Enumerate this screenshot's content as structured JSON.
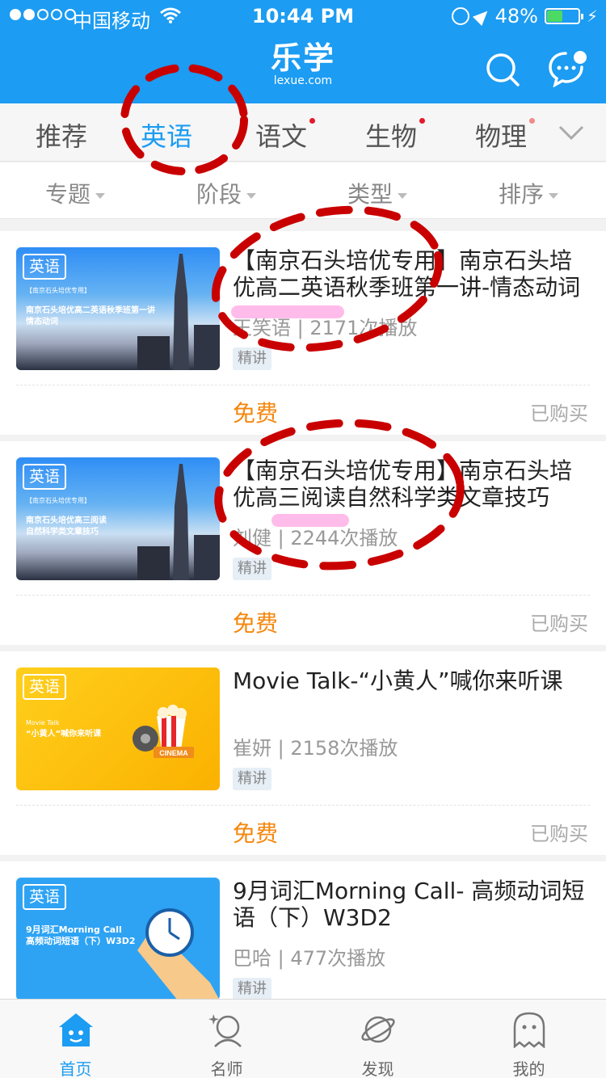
{
  "status_bar": {
    "carrier": "中国移动",
    "time": "10:44 PM",
    "battery": "48%",
    "battery_level": 0.48
  },
  "header": {
    "logo": "乐学",
    "logo_sub": "lexue.com"
  },
  "tabs": [
    {
      "label": "推荐",
      "active": false,
      "badge": false
    },
    {
      "label": "英语",
      "active": true,
      "badge": false
    },
    {
      "label": "语文",
      "active": false,
      "badge": true
    },
    {
      "label": "生物",
      "active": false,
      "badge": true
    },
    {
      "label": "物理",
      "active": false,
      "badge": true
    }
  ],
  "filters": [
    {
      "label": "专题"
    },
    {
      "label": "阶段"
    },
    {
      "label": "类型"
    },
    {
      "label": "排序"
    }
  ],
  "courses": [
    {
      "subject_tag": "英语",
      "thumb_small": "【南京石头培优专用】",
      "thumb_line1": "南京石头培优高二英语秋季班第一讲",
      "thumb_line2": "情态动词",
      "title": "【南京石头培优专用】南京石头培优高二英语秋季班第一讲-情态动词",
      "meta": "王笑语 | 2171次播放",
      "tag": "精讲",
      "price": "免费",
      "status": "已购买"
    },
    {
      "subject_tag": "英语",
      "thumb_small": "【南京石头培优专用】",
      "thumb_line1": "南京石头培优高三阅读",
      "thumb_line2": "自然科学类文章技巧",
      "title": "【南京石头培优专用】南京石头培优高三阅读自然科学类文章技巧",
      "meta": "刘健 | 2244次播放",
      "tag": "精讲",
      "price": "免费",
      "status": "已购买"
    },
    {
      "subject_tag": "英语",
      "thumb_small": "Movie Talk",
      "thumb_line1": "“小黄人”喊你来听课",
      "thumb_line2": "CINEMA",
      "title": "Movie Talk-“小黄人”喊你来听课",
      "meta": "崔妍 | 2158次播放",
      "tag": "精讲",
      "price": "免费",
      "status": "已购买"
    },
    {
      "subject_tag": "英语",
      "thumb_small": "",
      "thumb_line1": "9月词汇Morning Call",
      "thumb_line2": "高频动词短语（下）W3D2",
      "title": "9月词汇Morning Call- 高频动词短语（下）W3D2",
      "meta": "巴哈 | 477次播放",
      "tag": "精讲",
      "price": "",
      "status": ""
    }
  ],
  "bottom_nav": [
    {
      "label": "首页",
      "icon": "home-icon",
      "active": true
    },
    {
      "label": "名师",
      "icon": "teacher-icon",
      "active": false
    },
    {
      "label": "发现",
      "icon": "planet-icon",
      "active": false
    },
    {
      "label": "我的",
      "icon": "ghost-icon",
      "active": false
    }
  ],
  "colors": {
    "brand": "#1c9cf2",
    "price": "#f5860c",
    "badge": "#e5192c",
    "annotation": "#c90000"
  }
}
